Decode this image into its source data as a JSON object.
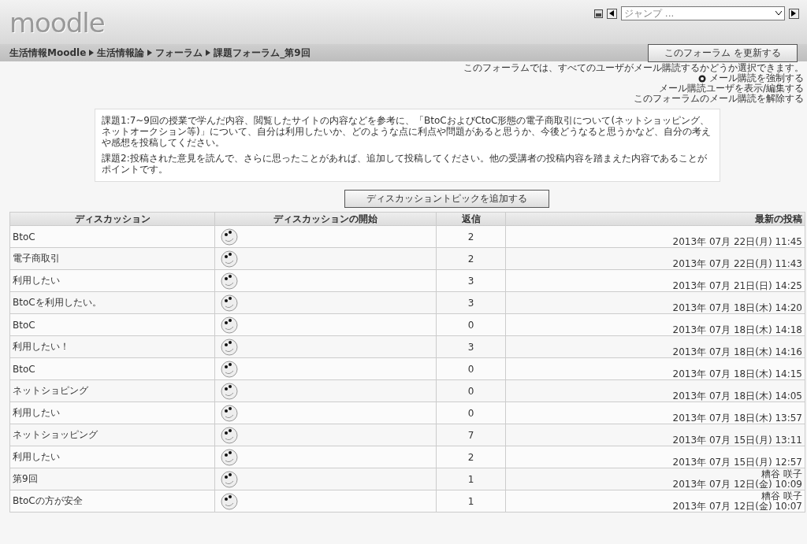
{
  "logo": "moodle",
  "header": {
    "jump_placeholder": "ジャンプ ..."
  },
  "breadcrumb": [
    "生活情報Moodle",
    "生活情報論",
    "フォーラム",
    "課題フォーラム_第9回"
  ],
  "update_button": "このフォーラム を更新する",
  "subscription": {
    "note": "このフォーラムでは、すべてのユーザがメール購読するかどうか選択できます。",
    "links": [
      "メール購読を強制する",
      "メール購読ユーザを表示/編集する",
      "このフォーラムのメール購読を解除する"
    ]
  },
  "intro": [
    "課題1:7~9回の授業で学んだ内容、閲覧したサイトの内容などを参考に、「BtoCおよびCtoC形態の電子商取引について(ネットショッピング、ネットオークション等)」について、自分は利用したいか、どのような点に利点や問題があると思うか、今後どうなると思うかなど、自分の考えや感想を投稿してください。",
    "課題2:投稿された意見を読んで、さらに思ったことがあれば、追加して投稿してください。他の受講者の投稿内容を踏まえた内容であることがポイントです。"
  ],
  "add_button": "ディスカッショントピックを追加する",
  "table": {
    "columns": [
      "ディスカッション",
      "ディスカッションの開始",
      "返信",
      "最新の投稿"
    ],
    "rows": [
      {
        "topic": "BtoC",
        "replies": "2",
        "date": "2013年 07月 22日(月) 11:45"
      },
      {
        "topic": "電子商取引",
        "replies": "2",
        "date": "2013年 07月 22日(月) 11:43"
      },
      {
        "topic": "利用したい",
        "replies": "3",
        "date": "2013年 07月 21日(日) 14:25"
      },
      {
        "topic": "BtoCを利用したい。",
        "replies": "3",
        "date": "2013年 07月 18日(木) 14:20"
      },
      {
        "topic": "BtoC",
        "replies": "0",
        "date": "2013年 07月 18日(木) 14:18"
      },
      {
        "topic": "利用したい！",
        "replies": "3",
        "date": "2013年 07月 18日(木) 14:16"
      },
      {
        "topic": "BtoC",
        "replies": "0",
        "date": "2013年 07月 18日(木) 14:15"
      },
      {
        "topic": "ネットショピング",
        "replies": "0",
        "date": "2013年 07月 18日(木) 14:05"
      },
      {
        "topic": "利用したい",
        "replies": "0",
        "date": "2013年 07月 18日(木) 13:57"
      },
      {
        "topic": "ネットショッピング",
        "replies": "7",
        "date": "2013年 07月 15日(月) 13:11"
      },
      {
        "topic": "利用したい",
        "replies": "2",
        "date": "2013年 07月 15日(月) 12:57"
      },
      {
        "topic": "第9回",
        "replies": "1",
        "last_author": "糟谷 咲子",
        "date": "2013年 07月 12日(金) 10:09"
      },
      {
        "topic": "BtoCの方が安全",
        "replies": "1",
        "last_author": "糟谷 咲子",
        "date": "2013年 07月 12日(金) 10:07"
      }
    ]
  }
}
